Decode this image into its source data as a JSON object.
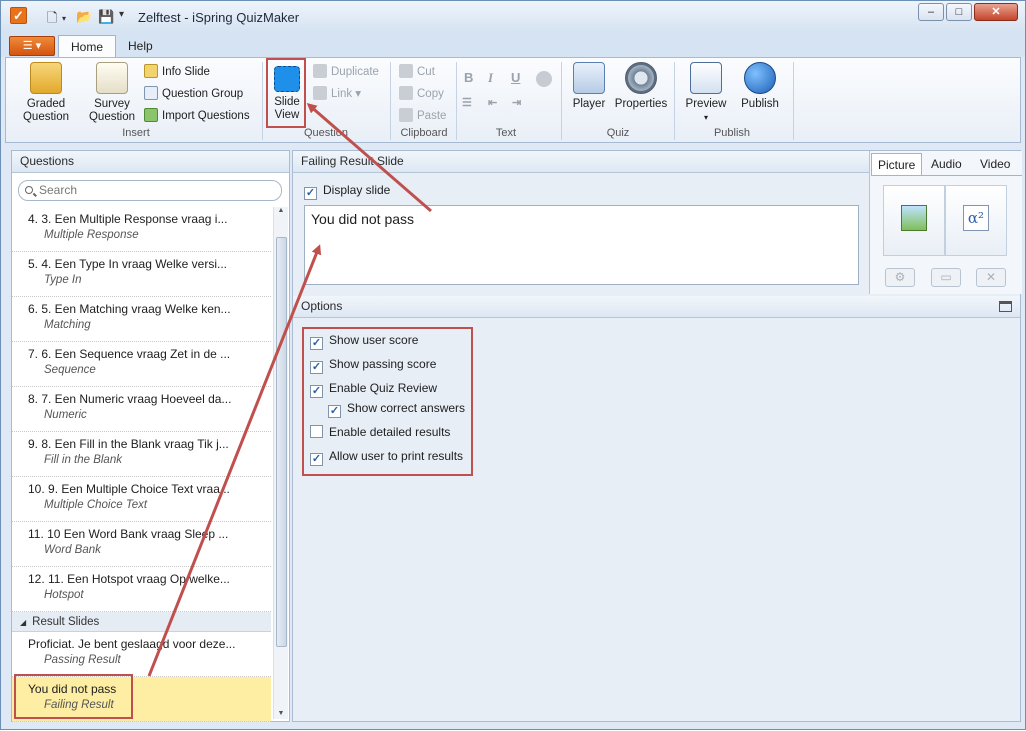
{
  "window": {
    "title": "Zelftest - iSpring QuizMaker",
    "controls": {
      "minimize": "‒",
      "maximize": "□",
      "close": "✕"
    }
  },
  "ribbon": {
    "tabs": [
      "Home",
      "Help"
    ],
    "groups": {
      "insert": {
        "label": "Insert",
        "graded_question": "Graded Question",
        "survey_question": "Survey Question",
        "info_slide": "Info Slide",
        "question_group": "Question Group",
        "import_questions": "Import Questions"
      },
      "question": {
        "label": "Question",
        "slide_view": "Slide View",
        "duplicate": "Duplicate",
        "link": "Link"
      },
      "clipboard": {
        "label": "Clipboard",
        "cut": "Cut",
        "copy": "Copy",
        "paste": "Paste"
      },
      "text": {
        "label": "Text",
        "bold": "B",
        "italic": "I",
        "underline": "U"
      },
      "quiz": {
        "label": "Quiz",
        "player": "Player",
        "properties": "Properties"
      },
      "publish": {
        "label": "Publish",
        "preview": "Preview",
        "publish": "Publish"
      }
    }
  },
  "questions_panel": {
    "title": "Questions",
    "search_placeholder": "Search",
    "items": [
      {
        "title": "4. 3. Een Multiple Response vraag  i...",
        "type": "Multiple Response"
      },
      {
        "title": "5. 4. Een Type In vraag  Welke versi...",
        "type": "Type In"
      },
      {
        "title": "6. 5. Een Matching vraag  Welke ken...",
        "type": "Matching"
      },
      {
        "title": "7. 6. Een Sequence vraag  Zet in de ...",
        "type": "Sequence"
      },
      {
        "title": "8. 7. Een Numeric vraag  Hoeveel da...",
        "type": "Numeric"
      },
      {
        "title": "9. 8. Een Fill in the Blank vraag  Tik j...",
        "type": "Fill in the Blank"
      },
      {
        "title": "10. 9. Een Multiple Choice Text vraa...",
        "type": "Multiple Choice Text"
      },
      {
        "title": "11. 10 Een Word Bank vraag  Sleep ...",
        "type": "Word Bank"
      },
      {
        "title": "12. 11. Een Hotspot vraag  Op welke...",
        "type": "Hotspot"
      }
    ],
    "result_section": "Result Slides",
    "results": [
      {
        "title": "Proficiat. Je bent geslaagd voor deze...",
        "type": "Passing Result"
      },
      {
        "title": "You did not pass",
        "type": "Failing Result"
      }
    ]
  },
  "slide_editor": {
    "header": "Failing Result Slide",
    "display_slide_label": "Display slide",
    "display_slide_checked": true,
    "text": "You did not pass",
    "media_tabs": [
      "Picture",
      "Audio",
      "Video"
    ]
  },
  "options": {
    "header": "Options",
    "items": [
      {
        "label": "Show user score",
        "checked": true,
        "indent": false
      },
      {
        "label": "Show passing score",
        "checked": true,
        "indent": false
      },
      {
        "label": "Enable Quiz Review",
        "checked": true,
        "indent": false
      },
      {
        "label": "Show correct answers",
        "checked": true,
        "indent": true
      },
      {
        "label": "Enable detailed results",
        "checked": false,
        "indent": false
      },
      {
        "label": "Allow user to print results",
        "checked": true,
        "indent": false
      }
    ]
  },
  "colors": {
    "highlight": "#c0504d",
    "accent": "#e8731a",
    "selected_row": "#fdeea4"
  }
}
